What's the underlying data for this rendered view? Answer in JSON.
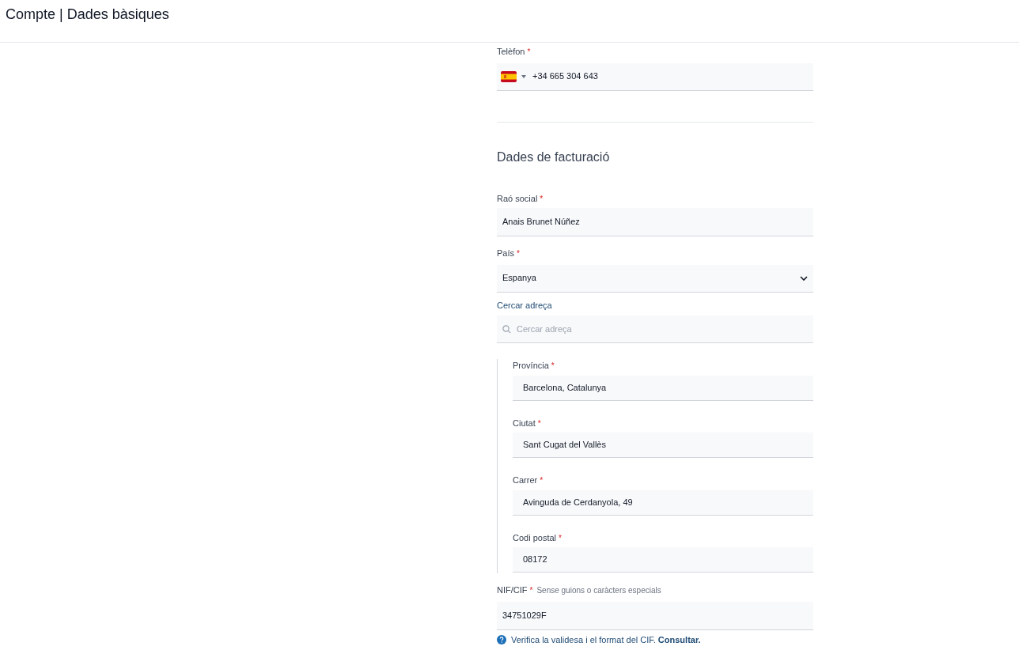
{
  "header": {
    "title": "Compte | Dades bàsiques"
  },
  "phone": {
    "label": "Telèfon",
    "required_mark": "*",
    "value": "+34 665 304 643"
  },
  "section_title": "Dades de facturació",
  "fields": [
    {
      "kind": "text",
      "label": "Raó social",
      "required_mark": "*",
      "value": "Anais Brunet Núñez"
    },
    {
      "kind": "select",
      "label": "País",
      "required_mark": "*",
      "value": "Espanya"
    },
    {
      "kind": "search",
      "label": "Cercar adreça",
      "placeholder": "Cercar adreça"
    }
  ],
  "address_fields": [
    {
      "label": "Província",
      "required_mark": "*",
      "value": "Barcelona, Catalunya"
    },
    {
      "label": "Ciutat",
      "required_mark": "*",
      "value": "Sant Cugat del Vallès"
    },
    {
      "label": "Carrer",
      "required_mark": "*",
      "value": "Avinguda de Cerdanyola, 49"
    },
    {
      "label": "Codi postal",
      "required_mark": "*",
      "value": "08172"
    }
  ],
  "tax_id": {
    "label": "NIF/CIF",
    "required_mark": "*",
    "hint": "Sense guions o caràcters especials",
    "value": "34751029F",
    "help": "Verifica la validesa i el format del CIF.",
    "help_link": "Consultar."
  }
}
